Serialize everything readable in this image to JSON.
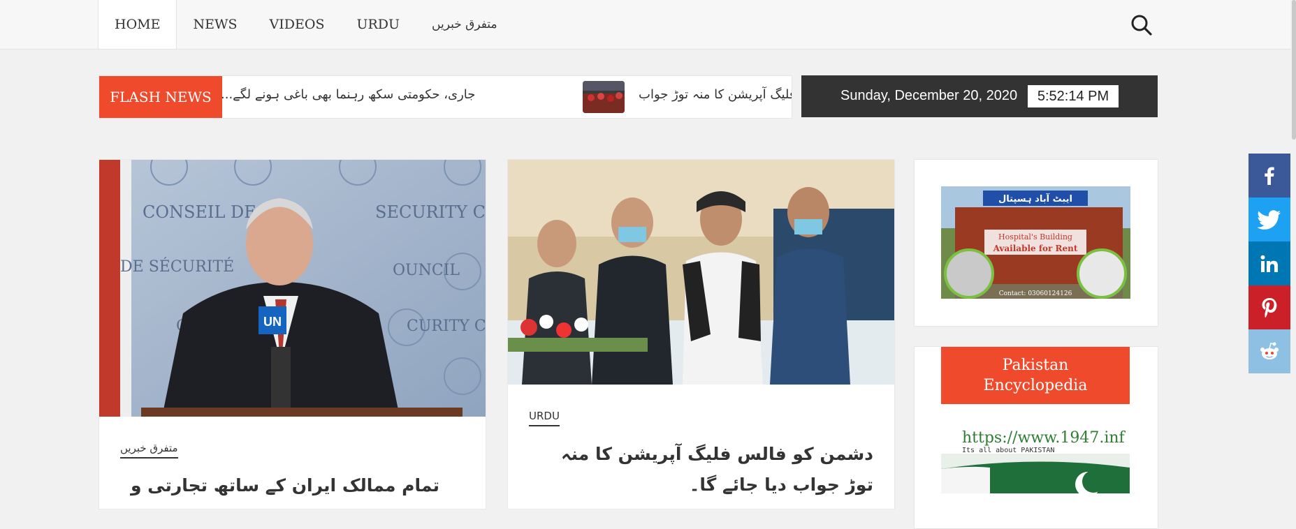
{
  "nav": {
    "items": [
      {
        "label": "HOME"
      },
      {
        "label": "NEWS"
      },
      {
        "label": "VIDEOS"
      },
      {
        "label": "URDU"
      },
      {
        "label": "متفرق خبریں"
      }
    ]
  },
  "flash": {
    "label": "FLASH NEWS",
    "ticker": [
      "...جاری، حکومتی سکھ رہنما بھی باغی ہونے لگے",
      "دشمن کو فالس فلیگ آپریشن کا منہ توڑ جواب..."
    ]
  },
  "datebar": {
    "date": "Sunday, December 20, 2020",
    "time": "5:52:14 PM"
  },
  "cards": [
    {
      "category": "متفرق خبریں",
      "headline": "تمام ممالک ایران کے ساتھ تجارتی و اقتصادی",
      "image_text": [
        "CONSEIL DE SÉCURITÉ",
        "SECURITY COUNCIL",
        "UN"
      ]
    },
    {
      "category": "URDU",
      "headline": "دشمن کو فالس فلیگ آپریشن کا منہ توڑ جواب دیا جائے گا۔"
    }
  ],
  "sidebar": {
    "ad": {
      "banner_top": "ایبٹ آباد ہسپتال",
      "line1": "Hospital's Building",
      "line2": "Available for Rent",
      "contact": "Contact: 03060124126"
    },
    "encyclopedia": {
      "title_line1": "Pakistan",
      "title_line2": "Encyclopedia",
      "url": "https://www.1947.inf",
      "tagline": "Its all about PAKISTAN"
    }
  },
  "share": [
    {
      "icon": "facebook-icon",
      "color": "#3b5998",
      "glyph": "f"
    },
    {
      "icon": "twitter-icon",
      "color": "#1da1f2",
      "glyph": ""
    },
    {
      "icon": "linkedin-icon",
      "color": "#0077b5",
      "glyph": "in"
    },
    {
      "icon": "pinterest-icon",
      "color": "#cb2027",
      "glyph": "p"
    },
    {
      "icon": "reddit-icon",
      "color": "#8ec0e4",
      "glyph": ""
    }
  ],
  "colors": {
    "accent": "#ee4a2b",
    "dark": "#333333"
  }
}
